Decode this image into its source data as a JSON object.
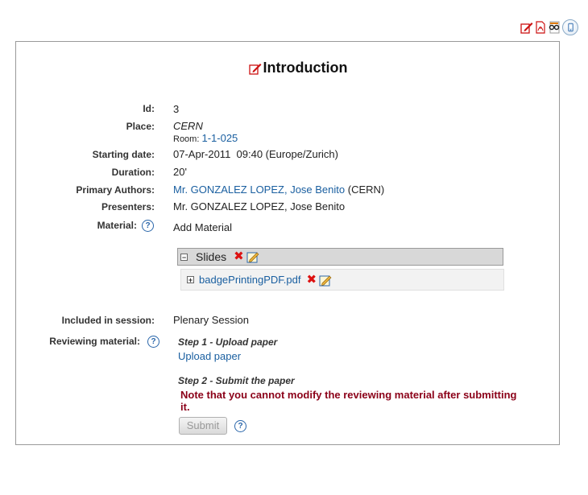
{
  "title": "Introduction",
  "fields": {
    "id_label": "Id:",
    "id_value": "3",
    "place_label": "Place:",
    "place_value": "CERN",
    "room_prefix": "Room:",
    "room_value": "1-1-025",
    "start_label": "Starting date:",
    "start_value": "07-Apr-2011  09:40 (Europe/Zurich)",
    "duration_label": "Duration:",
    "duration_value": "20'",
    "authors_label": "Primary Authors:",
    "author_name": "Mr. GONZALEZ LOPEZ, Jose Benito",
    "author_affiliation": "(CERN)",
    "presenters_label": "Presenters:",
    "presenters_value": "Mr. GONZALEZ LOPEZ, Jose Benito",
    "material_label": "Material:",
    "add_material": "Add Material",
    "session_label": "Included in session:",
    "session_value": "Plenary Session",
    "reviewing_label": "Reviewing material:"
  },
  "material": {
    "folder": "Slides",
    "file": "badgePrintingPDF.pdf"
  },
  "reviewing": {
    "step1": "Step 1 - Upload paper",
    "upload_link": "Upload paper",
    "step2": "Step 2 - Submit the paper",
    "warning": "Note that you cannot modify the reviewing material after submitting it.",
    "submit_label": "Submit"
  },
  "help_glyph": "?",
  "icons": [
    "edit-icon",
    "pdf-icon",
    "glasses-icon",
    "mobile-device-icon",
    "delete-icon",
    "edit-note-icon",
    "help-icon",
    "collapse-icon",
    "expand-icon"
  ],
  "colors": {
    "link": "#1a5fa0",
    "warning": "#8b0018",
    "edit_red": "#cc1111"
  }
}
